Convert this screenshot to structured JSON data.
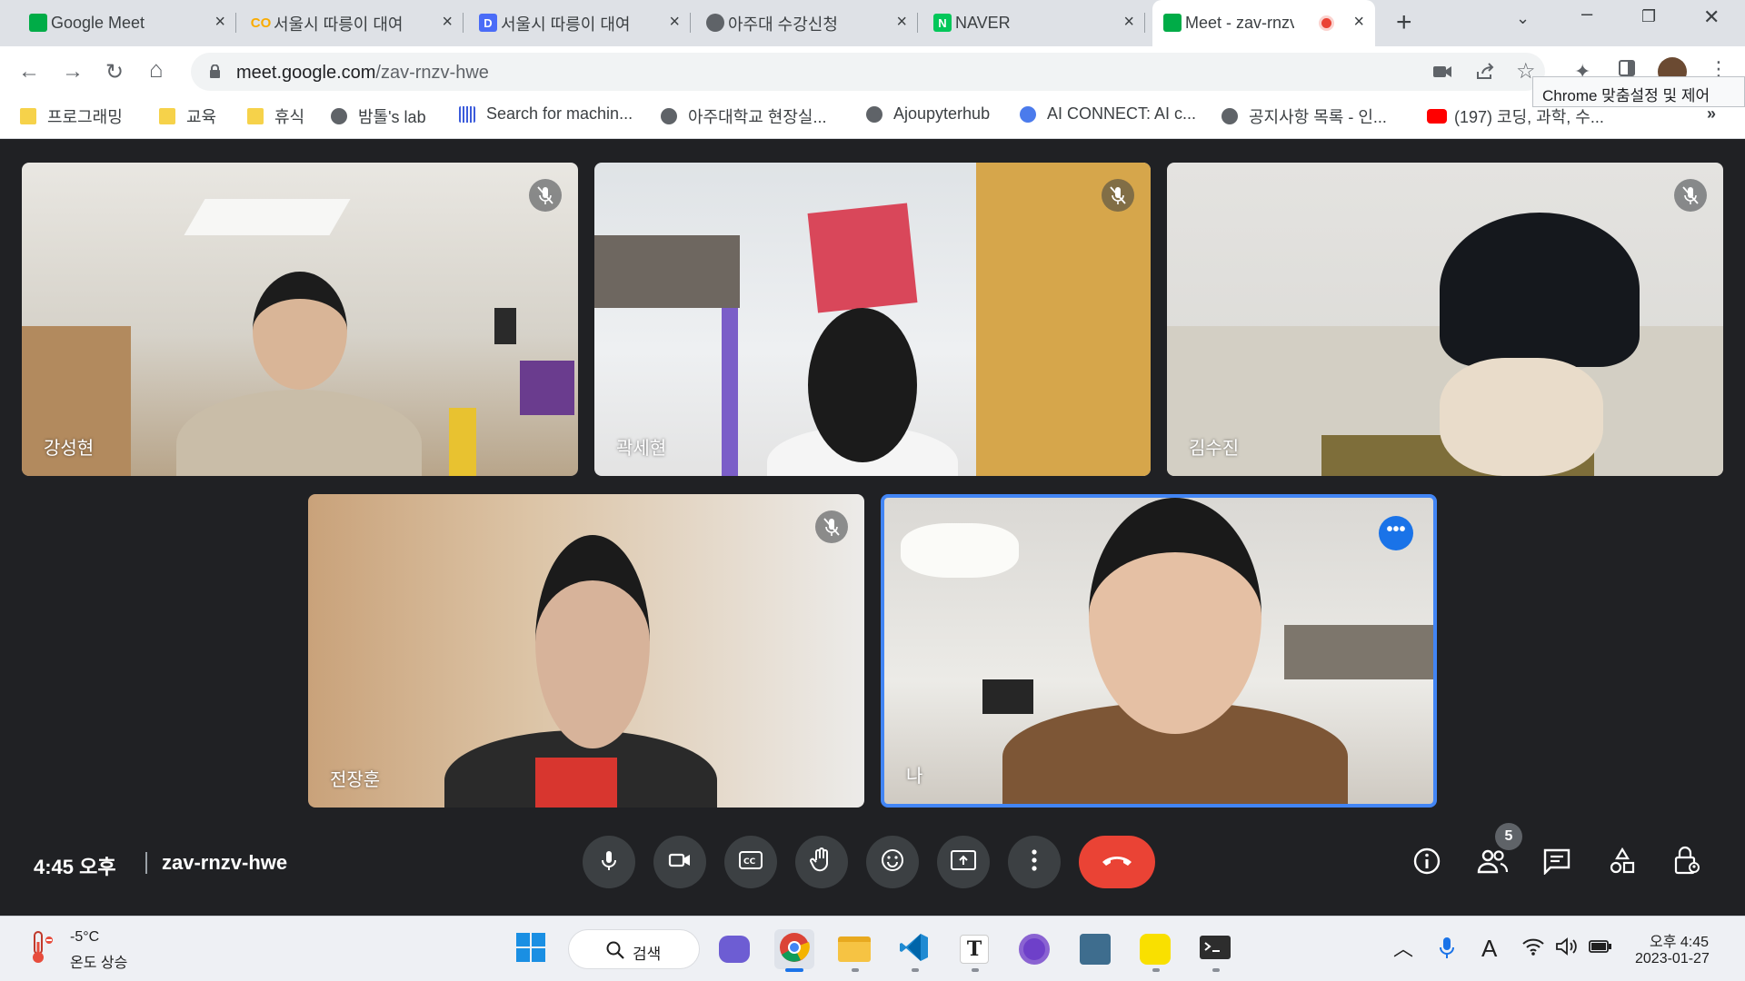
{
  "browser": {
    "tabs": [
      {
        "title": "Google Meet",
        "icon": "meet-icon"
      },
      {
        "title": "서울시 따릉이 대여",
        "icon": "colab-icon"
      },
      {
        "title": "서울시 따릉이 대여",
        "icon": "d-icon"
      },
      {
        "title": "아주대 수강신청",
        "icon": "globe-icon"
      },
      {
        "title": "NAVER",
        "icon": "naver-icon"
      },
      {
        "title": "Meet - zav-rnzv",
        "icon": "meet-icon"
      }
    ],
    "url_host": "meet.google.com",
    "url_path": "/zav-rnzv-hwe",
    "tooltip": "Chrome 맞춤설정 및 제어",
    "bookmarks": [
      {
        "label": "프로그래밍",
        "icon": "folder-icon"
      },
      {
        "label": "교육",
        "icon": "folder-icon"
      },
      {
        "label": "휴식",
        "icon": "folder-icon"
      },
      {
        "label": "밤톨's lab",
        "icon": "globe-icon"
      },
      {
        "label": "Search for machin...",
        "icon": "barcode-icon"
      },
      {
        "label": "아주대학교 현장실...",
        "icon": "globe-icon"
      },
      {
        "label": "Ajoupyterhub",
        "icon": "globe-icon"
      },
      {
        "label": "AI CONNECT: AI c...",
        "icon": "ai-icon"
      },
      {
        "label": "공지사항 목록 - 인...",
        "icon": "globe-icon"
      },
      {
        "label": "(197) 코딩, 과학, 수...",
        "icon": "youtube-icon"
      }
    ],
    "bookmarks_overflow": "»"
  },
  "meet": {
    "participants": [
      {
        "name": "강성현",
        "muted": true
      },
      {
        "name": "곽세현",
        "muted": true
      },
      {
        "name": "김수진",
        "muted": true
      },
      {
        "name": "전장훈",
        "muted": true
      },
      {
        "name": "나",
        "muted": false
      }
    ],
    "time": "4:45 오후",
    "meeting_code": "zav-rnzv-hwe",
    "people_count": "5",
    "more_options": "•••"
  },
  "taskbar": {
    "weather_temp": "-5°C",
    "weather_desc": "온도 상승",
    "search_label": "검색",
    "clock_time": "오후 4:45",
    "clock_date": "2023-01-27"
  },
  "colors": {
    "meet_bg": "#202124",
    "hangup": "#ea4335",
    "active_tile_border": "#4285f4",
    "button_bg": "#3c4043"
  }
}
